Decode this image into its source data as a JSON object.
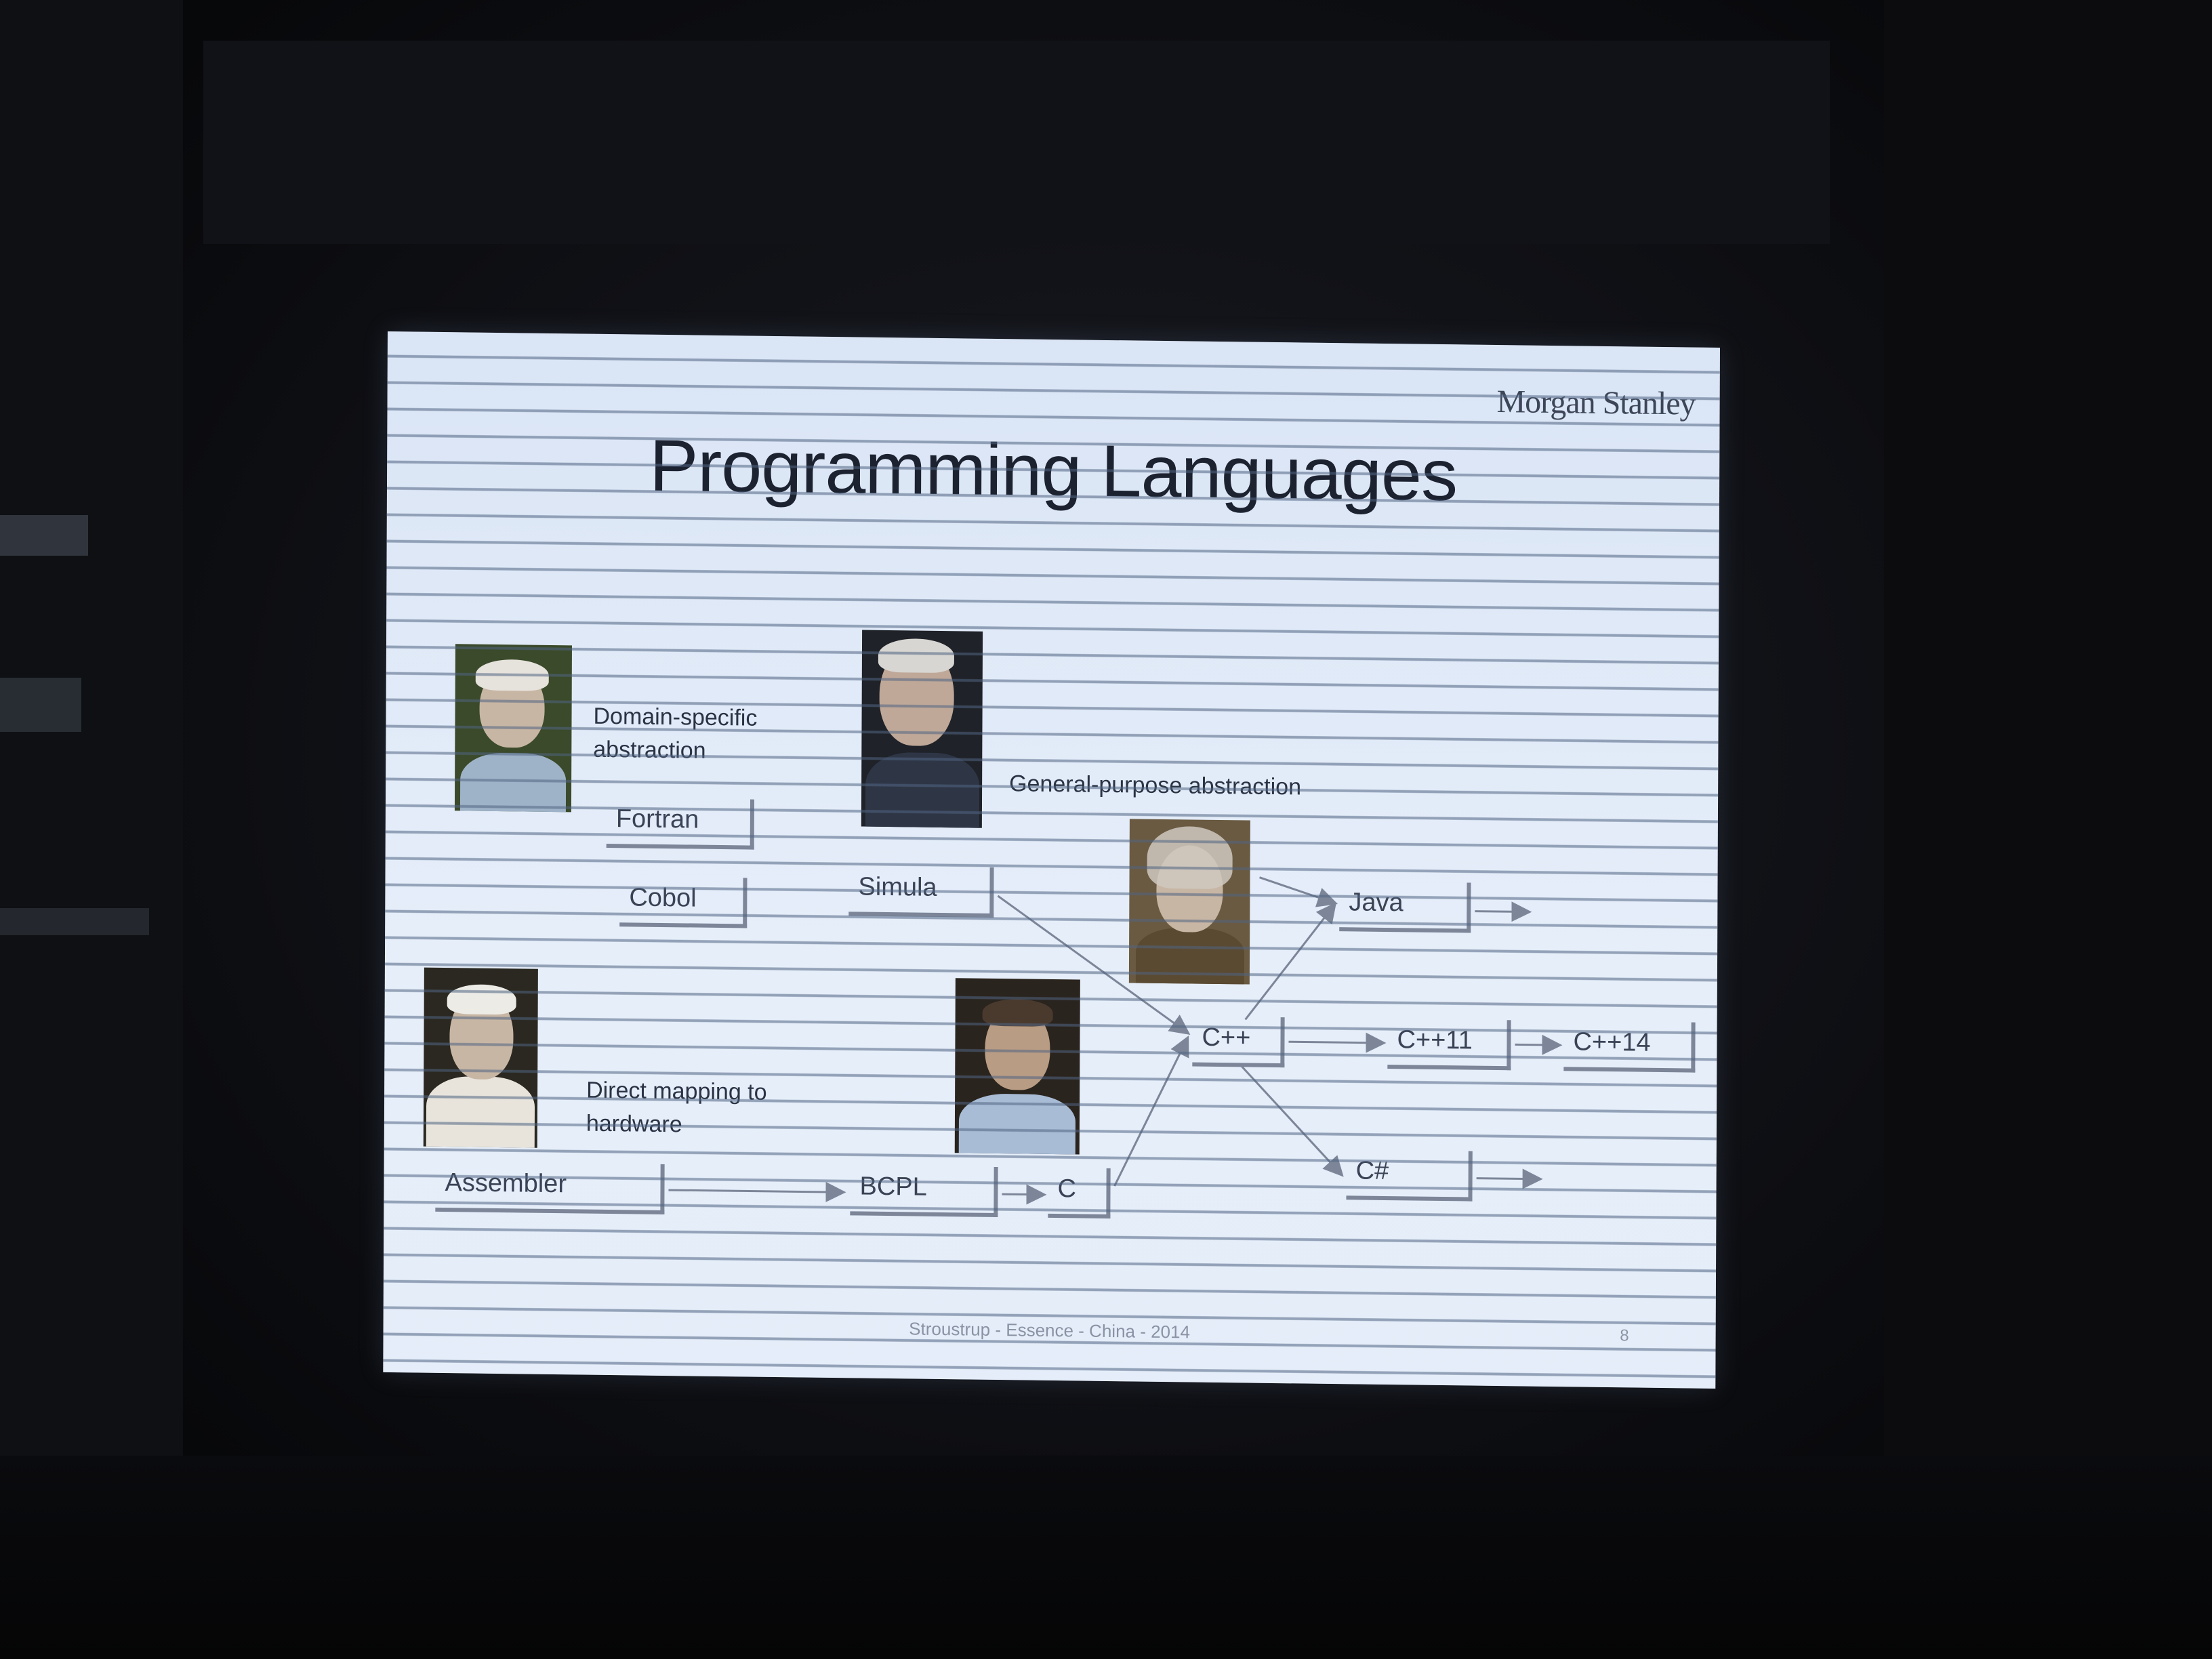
{
  "slide": {
    "brand": "Morgan Stanley",
    "title": "Programming Languages",
    "labels": {
      "domain_specific": "Domain-specific abstraction",
      "general_purpose": "General-purpose abstraction",
      "direct_mapping": "Direct mapping to hardware"
    },
    "languages": {
      "fortran": "Fortran",
      "cobol": "Cobol",
      "simula": "Simula",
      "java": "Java",
      "cpp": "C++",
      "cpp11": "C++11",
      "cpp14": "C++14",
      "csharp": "C#",
      "assembler": "Assembler",
      "bcpl": "BCPL",
      "c": "C"
    },
    "footer": "Stroustrup - Essence - China - 2014",
    "page_number": "8"
  }
}
